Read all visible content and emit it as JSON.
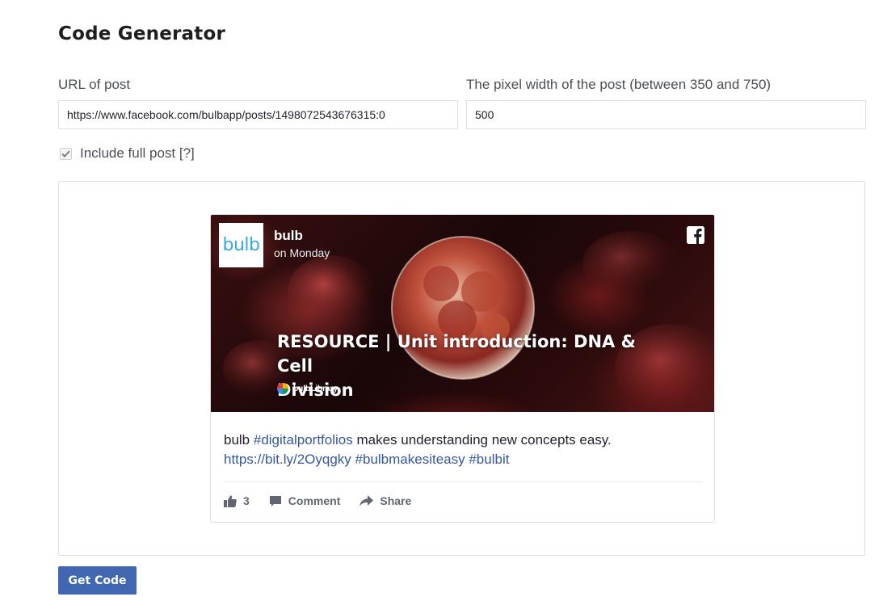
{
  "header": {
    "title": "Code Generator"
  },
  "form": {
    "url_label": "URL of post",
    "url_value": "https://www.facebook.com/bulbapp/posts/1498072543676315:0",
    "width_label": "The pixel width of the post (between 350 and 750)",
    "width_value": "500",
    "include_full_post_label": "Include full post [?]",
    "include_full_post_checked": true
  },
  "preview": {
    "page_name": "bulb",
    "avatar_text": "bulb",
    "post_time": "on Monday",
    "headline_line1": "RESOURCE | Unit introduction: DNA & Cell",
    "headline_line2": "Division",
    "brand_name": "bulbLibrary",
    "post_text": {
      "part1": "bulb ",
      "hashtag1": "#digitalportfolios",
      "part2": " makes understanding new concepts easy.",
      "link": "https://bit.ly/2Oyqgky",
      "hashtag2": "#bulbmakesiteasy",
      "hashtag3": "#bulbit"
    },
    "actions": {
      "like_count": "3",
      "comment_label": "Comment",
      "share_label": "Share"
    }
  },
  "footer": {
    "get_code_label": "Get Code"
  },
  "colors": {
    "brand_blue": "#4267b2",
    "link_blue": "#365899",
    "avatar_blue": "#36a9e1"
  }
}
